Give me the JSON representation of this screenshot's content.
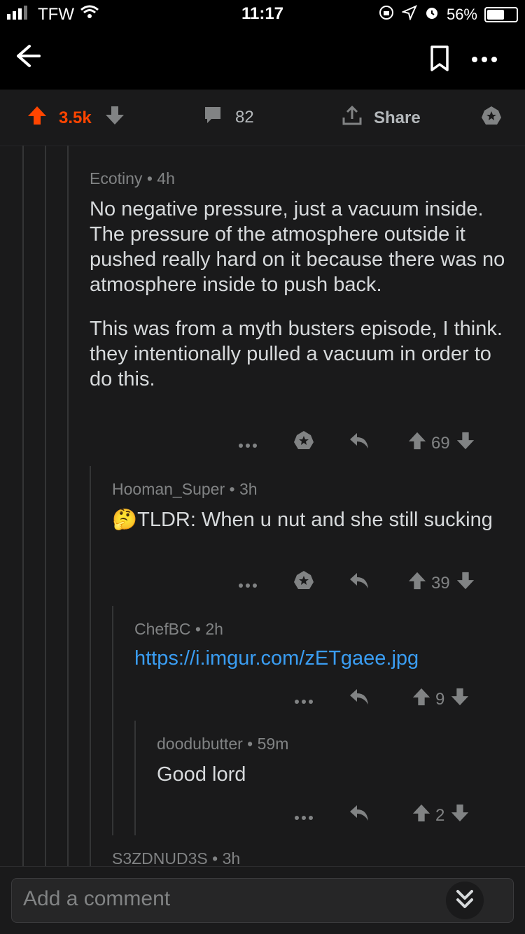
{
  "status": {
    "carrier": "TFW",
    "time": "11:17",
    "battery": "56%",
    "battery_level": 0.56
  },
  "post_bar": {
    "score": "3.5k",
    "comments": "82",
    "share": "Share"
  },
  "comments": [
    {
      "author": "Ecotiny",
      "age": "4h",
      "body": [
        "No negative pressure, just a vacuum inside. The pressure of the atmosphere outside it pushed really hard on it because there was no atmosphere inside to push back.",
        "This was from a myth busters episode, I think. they intentionally pulled a vacuum in order to do this."
      ],
      "score": "69"
    },
    {
      "author": "Hooman_Super",
      "age": "3h",
      "emoji": "🤔",
      "body": "TLDR: When u nut and she still sucking",
      "score": "39"
    },
    {
      "author": "ChefBC",
      "age": "2h",
      "link": "https://i.imgur.com/zETgaee.jpg",
      "score": "9"
    },
    {
      "author": "doodubutter",
      "age": "59m",
      "body": "Good lord",
      "score": "2"
    },
    {
      "author": "S3ZDNUD3S",
      "age": "3h"
    }
  ],
  "input": {
    "placeholder": "Add a comment"
  },
  "colors": {
    "upvote_active": "#ff4500",
    "link": "#3a9df2",
    "background": "#1a1a1b"
  }
}
